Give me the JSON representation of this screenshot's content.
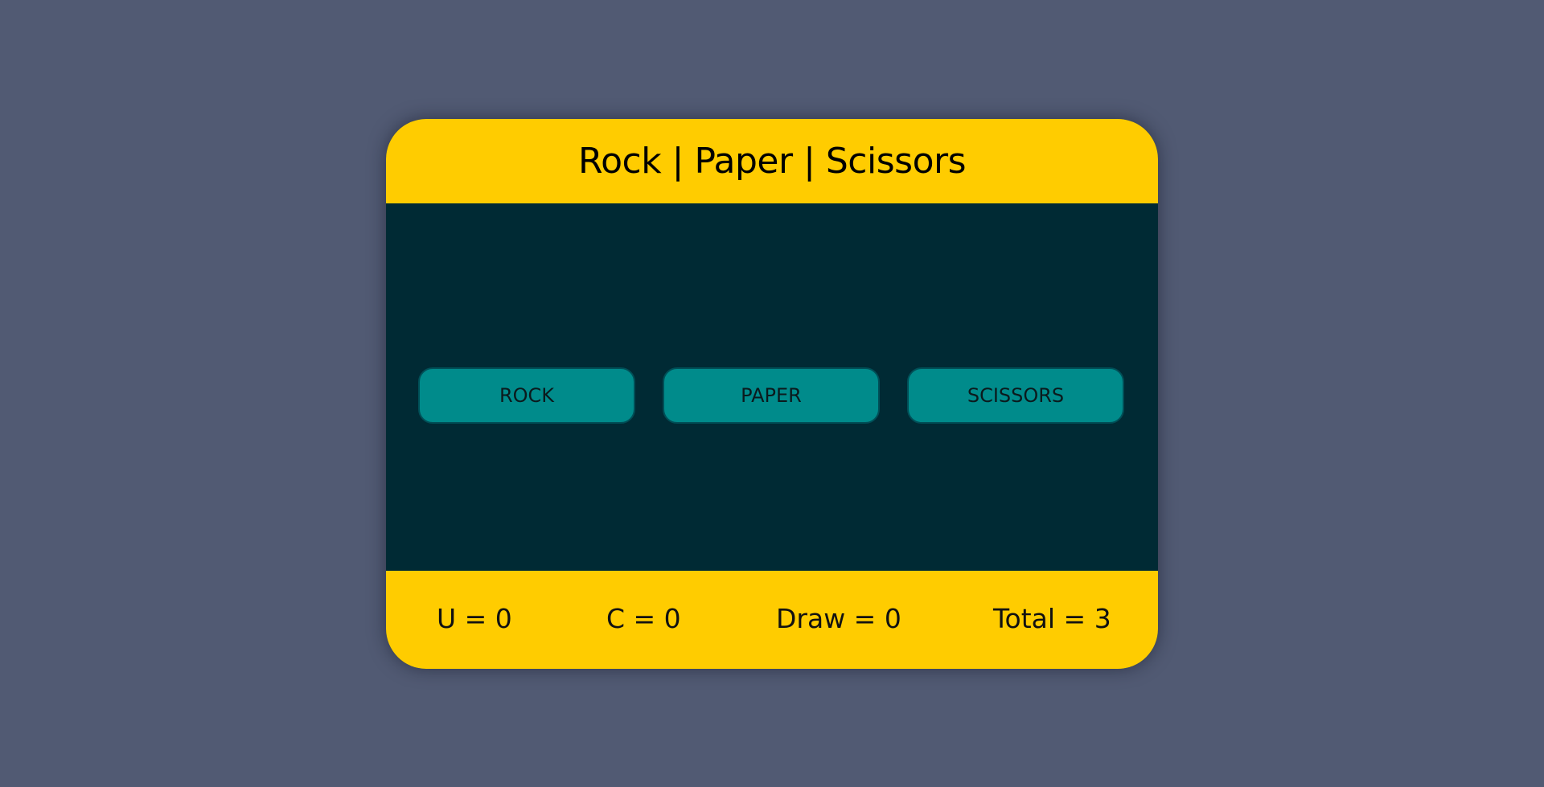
{
  "header": {
    "title": "Rock | Paper | Scissors"
  },
  "choices": {
    "rock_label": "ROCK",
    "paper_label": "PAPER",
    "scissors_label": "SCISSORS"
  },
  "scoreboard": {
    "user": "U = 0",
    "computer": "C = 0",
    "draw": "Draw = 0",
    "total": "Total = 3"
  },
  "colors": {
    "page_background": "#515a73",
    "accent_yellow": "#ffcc00",
    "stage_background": "#002a34",
    "button_teal": "#008b8b"
  }
}
